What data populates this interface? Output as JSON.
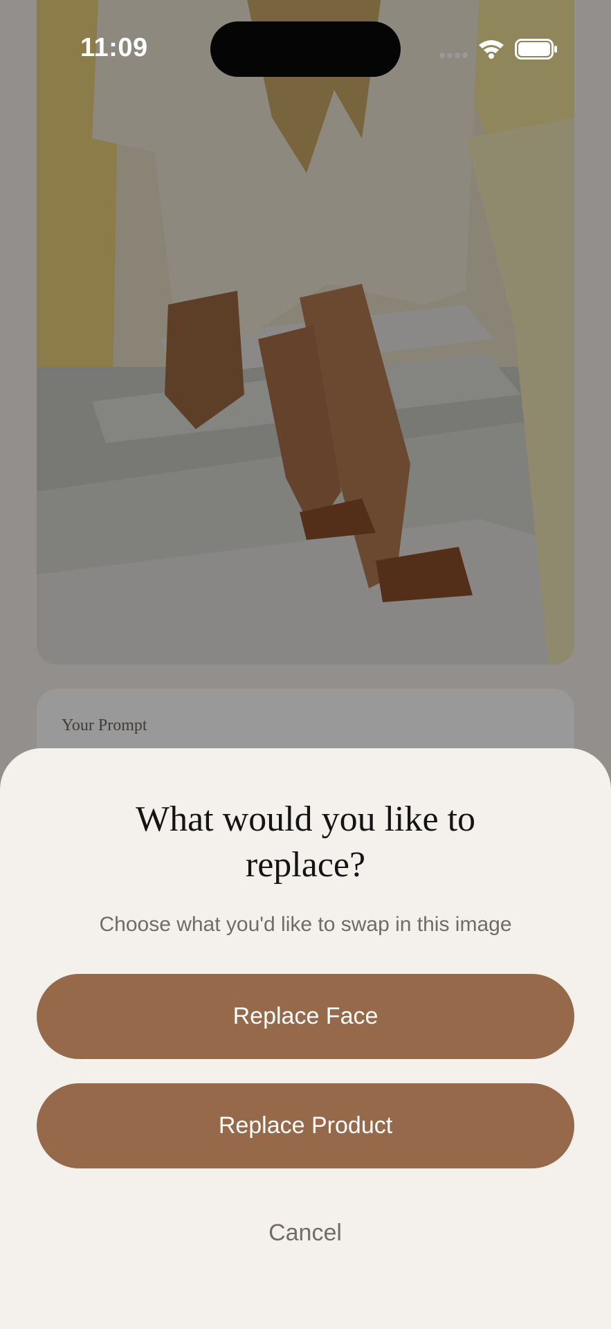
{
  "status_bar": {
    "time": "11:09"
  },
  "background": {
    "prompt_label": "Your Prompt"
  },
  "sheet": {
    "title": "What would you like to replace?",
    "subtitle": "Choose what you'd like to swap in this image",
    "replace_face_label": "Replace Face",
    "replace_product_label": "Replace Product",
    "cancel_label": "Cancel"
  },
  "colors": {
    "accent": "#96694b",
    "sheet_background": "#f4f0eb",
    "title_text": "#141414",
    "secondary_text": "#6f6b67"
  },
  "icons": [
    "signal-icon",
    "wifi-icon",
    "battery-icon"
  ]
}
